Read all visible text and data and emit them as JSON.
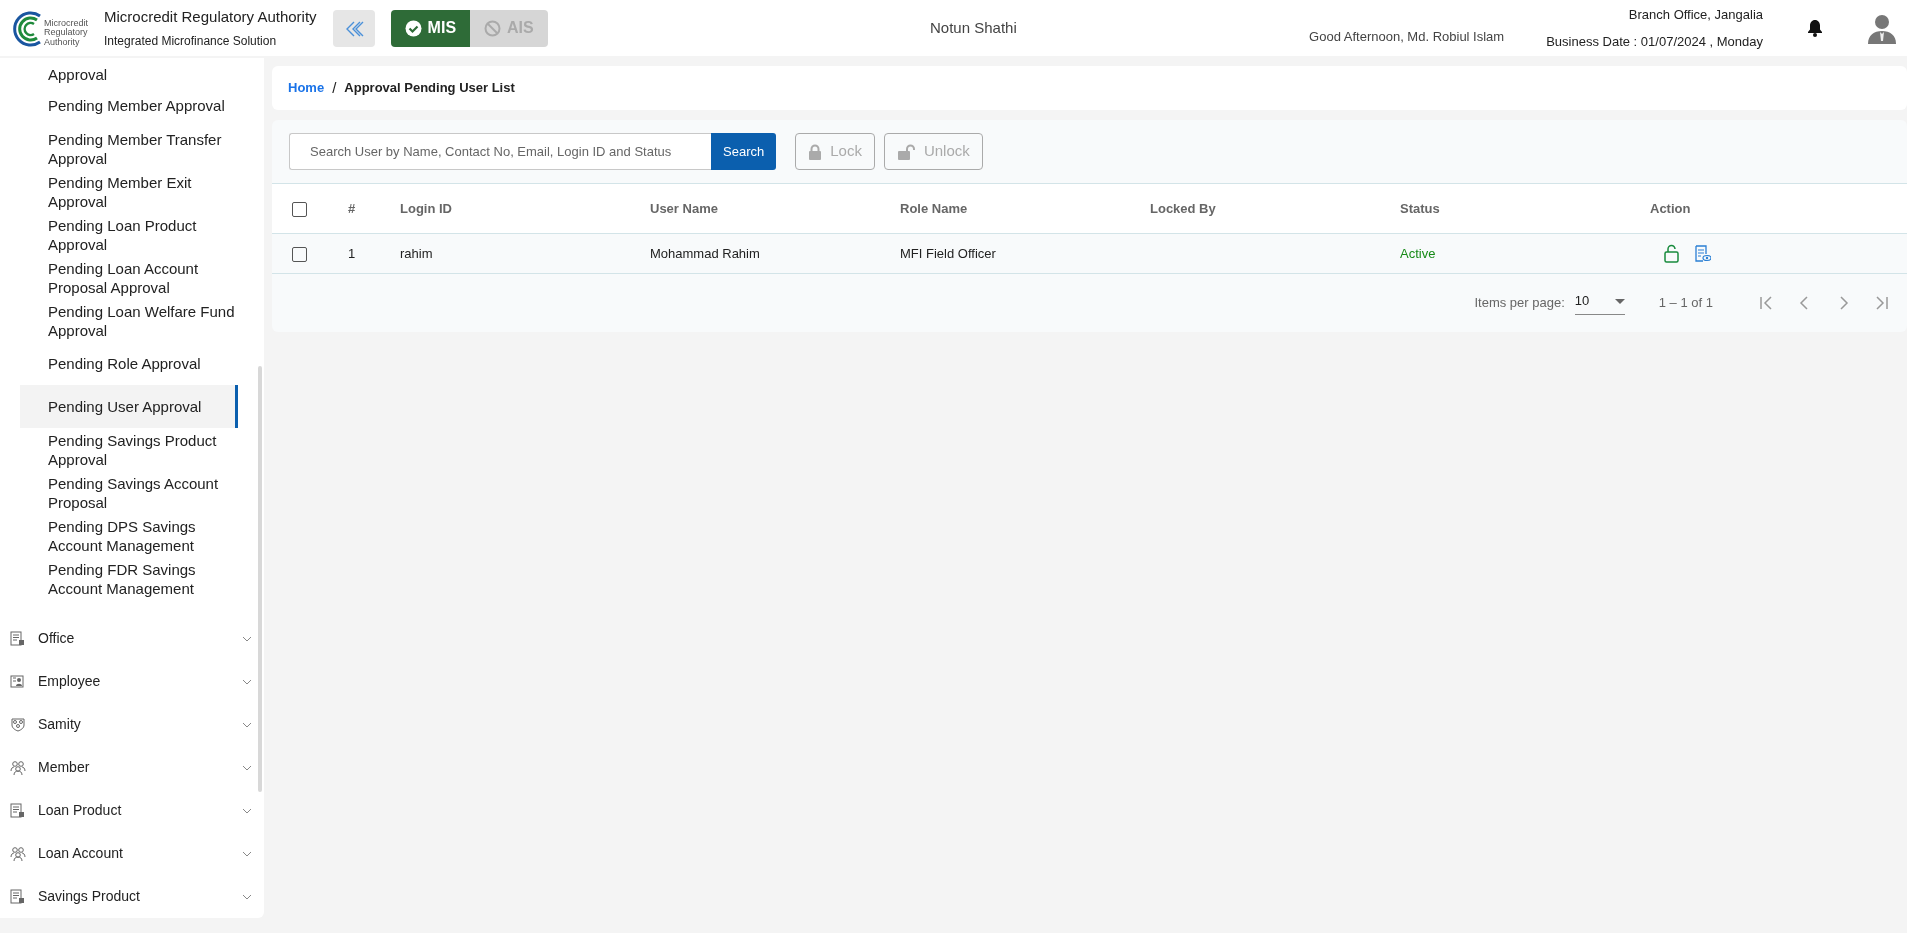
{
  "header": {
    "logo_text": [
      "Microcredit",
      "Regulatory",
      "Authority"
    ],
    "org_name": "Microcredit Regulatory Authority",
    "subtitle": "Integrated Microfinance Solution",
    "modules": [
      {
        "label": "MIS",
        "selected": true
      },
      {
        "label": "AIS",
        "selected": false
      }
    ],
    "center_title": "Notun Shathi",
    "greeting": "Good Afternoon, Md. Robiul Islam",
    "branch": "Branch Office, Jangalia",
    "business_date": "Business Date : 01/07/2024 , Monday"
  },
  "sidebar": {
    "items": [
      {
        "label": "Approval",
        "selected": false
      },
      {
        "label": "Pending Member Approval",
        "selected": false
      },
      {
        "label": "Pending Member Transfer Approval",
        "selected": false
      },
      {
        "label": "Pending Member Exit Approval",
        "selected": false
      },
      {
        "label": "Pending Loan Product Approval",
        "selected": false
      },
      {
        "label": "Pending Loan Account Proposal Approval",
        "selected": false
      },
      {
        "label": "Pending Loan Welfare Fund Approval",
        "selected": false
      },
      {
        "label": "Pending Role Approval",
        "selected": false
      },
      {
        "label": "Pending User Approval",
        "selected": true
      },
      {
        "label": "Pending Savings Product Approval",
        "selected": false
      },
      {
        "label": "Pending Savings Account Proposal",
        "selected": false
      },
      {
        "label": "Pending DPS Savings Account Management",
        "selected": false
      },
      {
        "label": "Pending FDR Savings Account Management",
        "selected": false
      }
    ],
    "groups": [
      {
        "label": "Office",
        "kind": "document"
      },
      {
        "label": "Employee",
        "kind": "badge"
      },
      {
        "label": "Samity",
        "kind": "shield"
      },
      {
        "label": "Member",
        "kind": "people"
      },
      {
        "label": "Loan Product",
        "kind": "document"
      },
      {
        "label": "Loan Account",
        "kind": "people"
      },
      {
        "label": "Savings Product",
        "kind": "document"
      }
    ]
  },
  "breadcrumb": {
    "home": "Home",
    "separator": "/",
    "current": "Approval Pending User List"
  },
  "toolbar": {
    "search": {
      "placeholder": "Search User by Name, Contact No, Email, Login ID and Status"
    },
    "search_button": "Search",
    "buttons": [
      {
        "label": "Lock",
        "kind": "lock",
        "disabled": true
      },
      {
        "label": "Unlock",
        "kind": "unlock",
        "disabled": true
      }
    ]
  },
  "table": {
    "header_checked": false,
    "columns": [
      "#",
      "Login ID",
      "User Name",
      "Role Name",
      "Locked By",
      "Status",
      "Action"
    ],
    "rows": [
      {
        "checked": false,
        "number": "1",
        "login_id": "rahim",
        "user_name": "Mohammad Rahim",
        "role_name": "MFI Field Officer",
        "status": "Active"
      }
    ]
  },
  "pagination": {
    "label": "Items per page:",
    "page_size": "10",
    "range": "1 – 1 of 1"
  }
}
